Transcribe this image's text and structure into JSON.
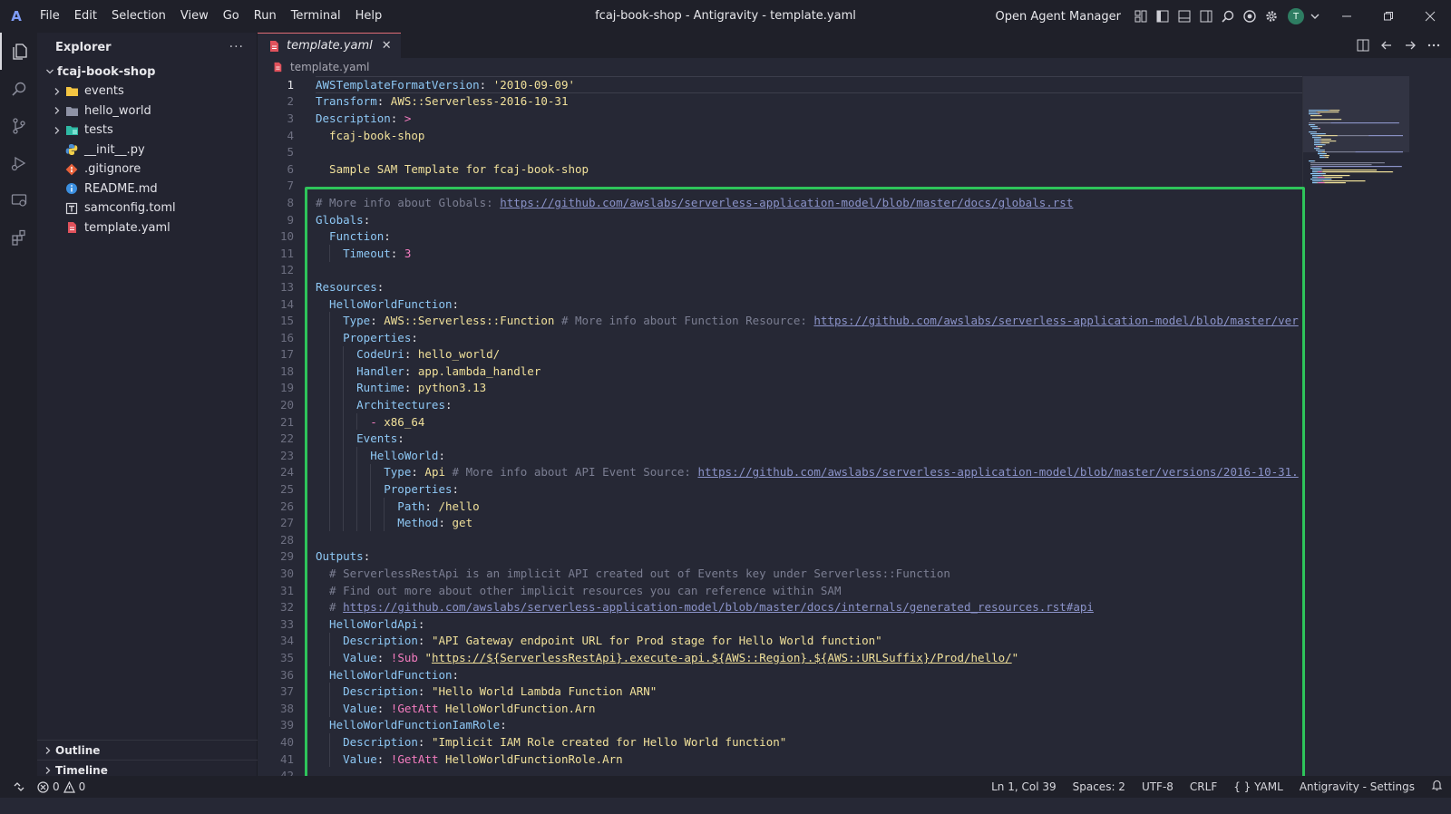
{
  "titlebar": {
    "app_logo": "A",
    "menu": [
      "File",
      "Edit",
      "Selection",
      "View",
      "Go",
      "Run",
      "Terminal",
      "Help"
    ],
    "window_title": "fcaj-book-shop - Antigravity - template.yaml",
    "agent_manager_label": "Open Agent Manager",
    "avatar_letter": "T"
  },
  "sidebar": {
    "title": "Explorer",
    "more": "···",
    "project": "fcaj-book-shop",
    "items": [
      {
        "label": "events",
        "type": "folder",
        "icon": "folder-yellow-icon"
      },
      {
        "label": "hello_world",
        "type": "folder",
        "icon": "folder-gray-icon"
      },
      {
        "label": "tests",
        "type": "folder",
        "icon": "folder-teal-icon"
      },
      {
        "label": "__init__.py",
        "type": "file",
        "icon": "python-icon"
      },
      {
        "label": ".gitignore",
        "type": "file",
        "icon": "git-icon"
      },
      {
        "label": "README.md",
        "type": "file",
        "icon": "info-icon"
      },
      {
        "label": "samconfig.toml",
        "type": "file",
        "icon": "toml-icon"
      },
      {
        "label": "template.yaml",
        "type": "file",
        "icon": "yaml-icon"
      }
    ],
    "outline": "Outline",
    "timeline": "Timeline"
  },
  "editor": {
    "tab_label": "template.yaml",
    "tab_close": "✕",
    "breadcrumb": "template.yaml"
  },
  "code_lines": [
    {
      "n": "1",
      "i": 0,
      "parts": [
        [
          "k",
          "AWSTemplateFormatVersion"
        ],
        [
          "p",
          ": "
        ],
        [
          "s",
          "'2010-09-09'"
        ]
      ]
    },
    {
      "n": "2",
      "i": 0,
      "parts": [
        [
          "k",
          "Transform"
        ],
        [
          "p",
          ": "
        ],
        [
          "s",
          "AWS::Serverless-2016-10-31"
        ]
      ]
    },
    {
      "n": "3",
      "i": 0,
      "parts": [
        [
          "k",
          "Description"
        ],
        [
          "p",
          ": "
        ],
        [
          "t",
          ">"
        ]
      ]
    },
    {
      "n": "4",
      "i": 1,
      "parts": [
        [
          "s",
          "fcaj-book-shop"
        ]
      ]
    },
    {
      "n": "5",
      "i": 0,
      "parts": []
    },
    {
      "n": "6",
      "i": 1,
      "parts": [
        [
          "s",
          "Sample SAM Template for fcaj-book-shop"
        ]
      ]
    },
    {
      "n": "7",
      "i": 0,
      "parts": []
    },
    {
      "n": "8",
      "i": 0,
      "parts": [
        [
          "c",
          "# More info about Globals: "
        ],
        [
          "u",
          "https://github.com/awslabs/serverless-application-model/blob/master/docs/globals.rst"
        ]
      ]
    },
    {
      "n": "9",
      "i": 0,
      "parts": [
        [
          "k",
          "Globals"
        ],
        [
          "p",
          ":"
        ]
      ]
    },
    {
      "n": "10",
      "i": 1,
      "parts": [
        [
          "k",
          "Function"
        ],
        [
          "p",
          ":"
        ]
      ]
    },
    {
      "n": "11",
      "i": 2,
      "parts": [
        [
          "k",
          "Timeout"
        ],
        [
          "p",
          ": "
        ],
        [
          "t",
          "3"
        ]
      ]
    },
    {
      "n": "12",
      "i": 0,
      "parts": []
    },
    {
      "n": "13",
      "i": 0,
      "parts": [
        [
          "k",
          "Resources"
        ],
        [
          "p",
          ":"
        ]
      ]
    },
    {
      "n": "14",
      "i": 1,
      "parts": [
        [
          "k",
          "HelloWorldFunction"
        ],
        [
          "p",
          ":"
        ]
      ]
    },
    {
      "n": "15",
      "i": 2,
      "parts": [
        [
          "k",
          "Type"
        ],
        [
          "p",
          ": "
        ],
        [
          "s",
          "AWS::Serverless::Function"
        ],
        [
          "c",
          " # More info about Function Resource: "
        ],
        [
          "u",
          "https://github.com/awslabs/serverless-application-model/blob/master/ver"
        ]
      ]
    },
    {
      "n": "16",
      "i": 2,
      "parts": [
        [
          "k",
          "Properties"
        ],
        [
          "p",
          ":"
        ]
      ]
    },
    {
      "n": "17",
      "i": 3,
      "parts": [
        [
          "k",
          "CodeUri"
        ],
        [
          "p",
          ": "
        ],
        [
          "s",
          "hello_world/"
        ]
      ]
    },
    {
      "n": "18",
      "i": 3,
      "parts": [
        [
          "k",
          "Handler"
        ],
        [
          "p",
          ": "
        ],
        [
          "s",
          "app.lambda_handler"
        ]
      ]
    },
    {
      "n": "19",
      "i": 3,
      "parts": [
        [
          "k",
          "Runtime"
        ],
        [
          "p",
          ": "
        ],
        [
          "s",
          "python3.13"
        ]
      ]
    },
    {
      "n": "20",
      "i": 3,
      "parts": [
        [
          "k",
          "Architectures"
        ],
        [
          "p",
          ":"
        ]
      ]
    },
    {
      "n": "21",
      "i": 4,
      "parts": [
        [
          "t",
          "- "
        ],
        [
          "s",
          "x86_64"
        ]
      ]
    },
    {
      "n": "22",
      "i": 3,
      "parts": [
        [
          "k",
          "Events"
        ],
        [
          "p",
          ":"
        ]
      ]
    },
    {
      "n": "23",
      "i": 4,
      "parts": [
        [
          "k",
          "HelloWorld"
        ],
        [
          "p",
          ":"
        ]
      ]
    },
    {
      "n": "24",
      "i": 5,
      "parts": [
        [
          "k",
          "Type"
        ],
        [
          "p",
          ": "
        ],
        [
          "s",
          "Api"
        ],
        [
          "c",
          " # More info about API Event Source: "
        ],
        [
          "u",
          "https://github.com/awslabs/serverless-application-model/blob/master/versions/2016-10-31."
        ]
      ]
    },
    {
      "n": "25",
      "i": 5,
      "parts": [
        [
          "k",
          "Properties"
        ],
        [
          "p",
          ":"
        ]
      ]
    },
    {
      "n": "26",
      "i": 6,
      "parts": [
        [
          "k",
          "Path"
        ],
        [
          "p",
          ": "
        ],
        [
          "s",
          "/hello"
        ]
      ]
    },
    {
      "n": "27",
      "i": 6,
      "parts": [
        [
          "k",
          "Method"
        ],
        [
          "p",
          ": "
        ],
        [
          "s",
          "get"
        ]
      ]
    },
    {
      "n": "28",
      "i": 0,
      "parts": []
    },
    {
      "n": "29",
      "i": 0,
      "parts": [
        [
          "k",
          "Outputs"
        ],
        [
          "p",
          ":"
        ]
      ]
    },
    {
      "n": "30",
      "i": 1,
      "parts": [
        [
          "c",
          "# ServerlessRestApi is an implicit API created out of Events key under Serverless::Function"
        ]
      ]
    },
    {
      "n": "31",
      "i": 1,
      "parts": [
        [
          "c",
          "# Find out more about other implicit resources you can reference within SAM"
        ]
      ]
    },
    {
      "n": "32",
      "i": 1,
      "parts": [
        [
          "c",
          "# "
        ],
        [
          "u",
          "https://github.com/awslabs/serverless-application-model/blob/master/docs/internals/generated_resources.rst#api"
        ]
      ]
    },
    {
      "n": "33",
      "i": 1,
      "parts": [
        [
          "k",
          "HelloWorldApi"
        ],
        [
          "p",
          ":"
        ]
      ]
    },
    {
      "n": "34",
      "i": 2,
      "parts": [
        [
          "k",
          "Description"
        ],
        [
          "p",
          ": "
        ],
        [
          "s",
          "\"API Gateway endpoint URL for Prod stage for Hello World function\""
        ]
      ]
    },
    {
      "n": "35",
      "i": 2,
      "parts": [
        [
          "k",
          "Value"
        ],
        [
          "p",
          ": "
        ],
        [
          "t",
          "!Sub "
        ],
        [
          "s",
          "\""
        ],
        [
          "su",
          "https://${ServerlessRestApi}.execute-api.${AWS::Region}.${AWS::URLSuffix}/Prod/hello/"
        ],
        [
          "s",
          "\""
        ]
      ]
    },
    {
      "n": "36",
      "i": 1,
      "parts": [
        [
          "k",
          "HelloWorldFunction"
        ],
        [
          "p",
          ":"
        ]
      ]
    },
    {
      "n": "37",
      "i": 2,
      "parts": [
        [
          "k",
          "Description"
        ],
        [
          "p",
          ": "
        ],
        [
          "s",
          "\"Hello World Lambda Function ARN\""
        ]
      ]
    },
    {
      "n": "38",
      "i": 2,
      "parts": [
        [
          "k",
          "Value"
        ],
        [
          "p",
          ": "
        ],
        [
          "t",
          "!GetAtt "
        ],
        [
          "s",
          "HelloWorldFunction.Arn"
        ]
      ]
    },
    {
      "n": "39",
      "i": 1,
      "parts": [
        [
          "k",
          "HelloWorldFunctionIamRole"
        ],
        [
          "p",
          ":"
        ]
      ]
    },
    {
      "n": "40",
      "i": 2,
      "parts": [
        [
          "k",
          "Description"
        ],
        [
          "p",
          ": "
        ],
        [
          "s",
          "\"Implicit IAM Role created for Hello World function\""
        ]
      ]
    },
    {
      "n": "41",
      "i": 2,
      "parts": [
        [
          "k",
          "Value"
        ],
        [
          "p",
          ": "
        ],
        [
          "t",
          "!GetAtt "
        ],
        [
          "s",
          "HelloWorldFunctionRole.Arn"
        ]
      ]
    },
    {
      "n": "42",
      "i": 0,
      "parts": []
    }
  ],
  "statusbar": {
    "errors": "0",
    "warnings": "0",
    "position": "Ln 1, Col 39",
    "spaces": "Spaces: 2",
    "encoding": "UTF-8",
    "eol": "CRLF",
    "language": "YAML",
    "language_icon": "{ }",
    "settings": "Antigravity - Settings"
  },
  "colors": {
    "highlight_box": "#2ec45a",
    "key": "#8ec8f5",
    "string": "#f0e09a",
    "comment": "#7b7e92",
    "url": "#8b93c9",
    "tag": "#f47cbf"
  }
}
